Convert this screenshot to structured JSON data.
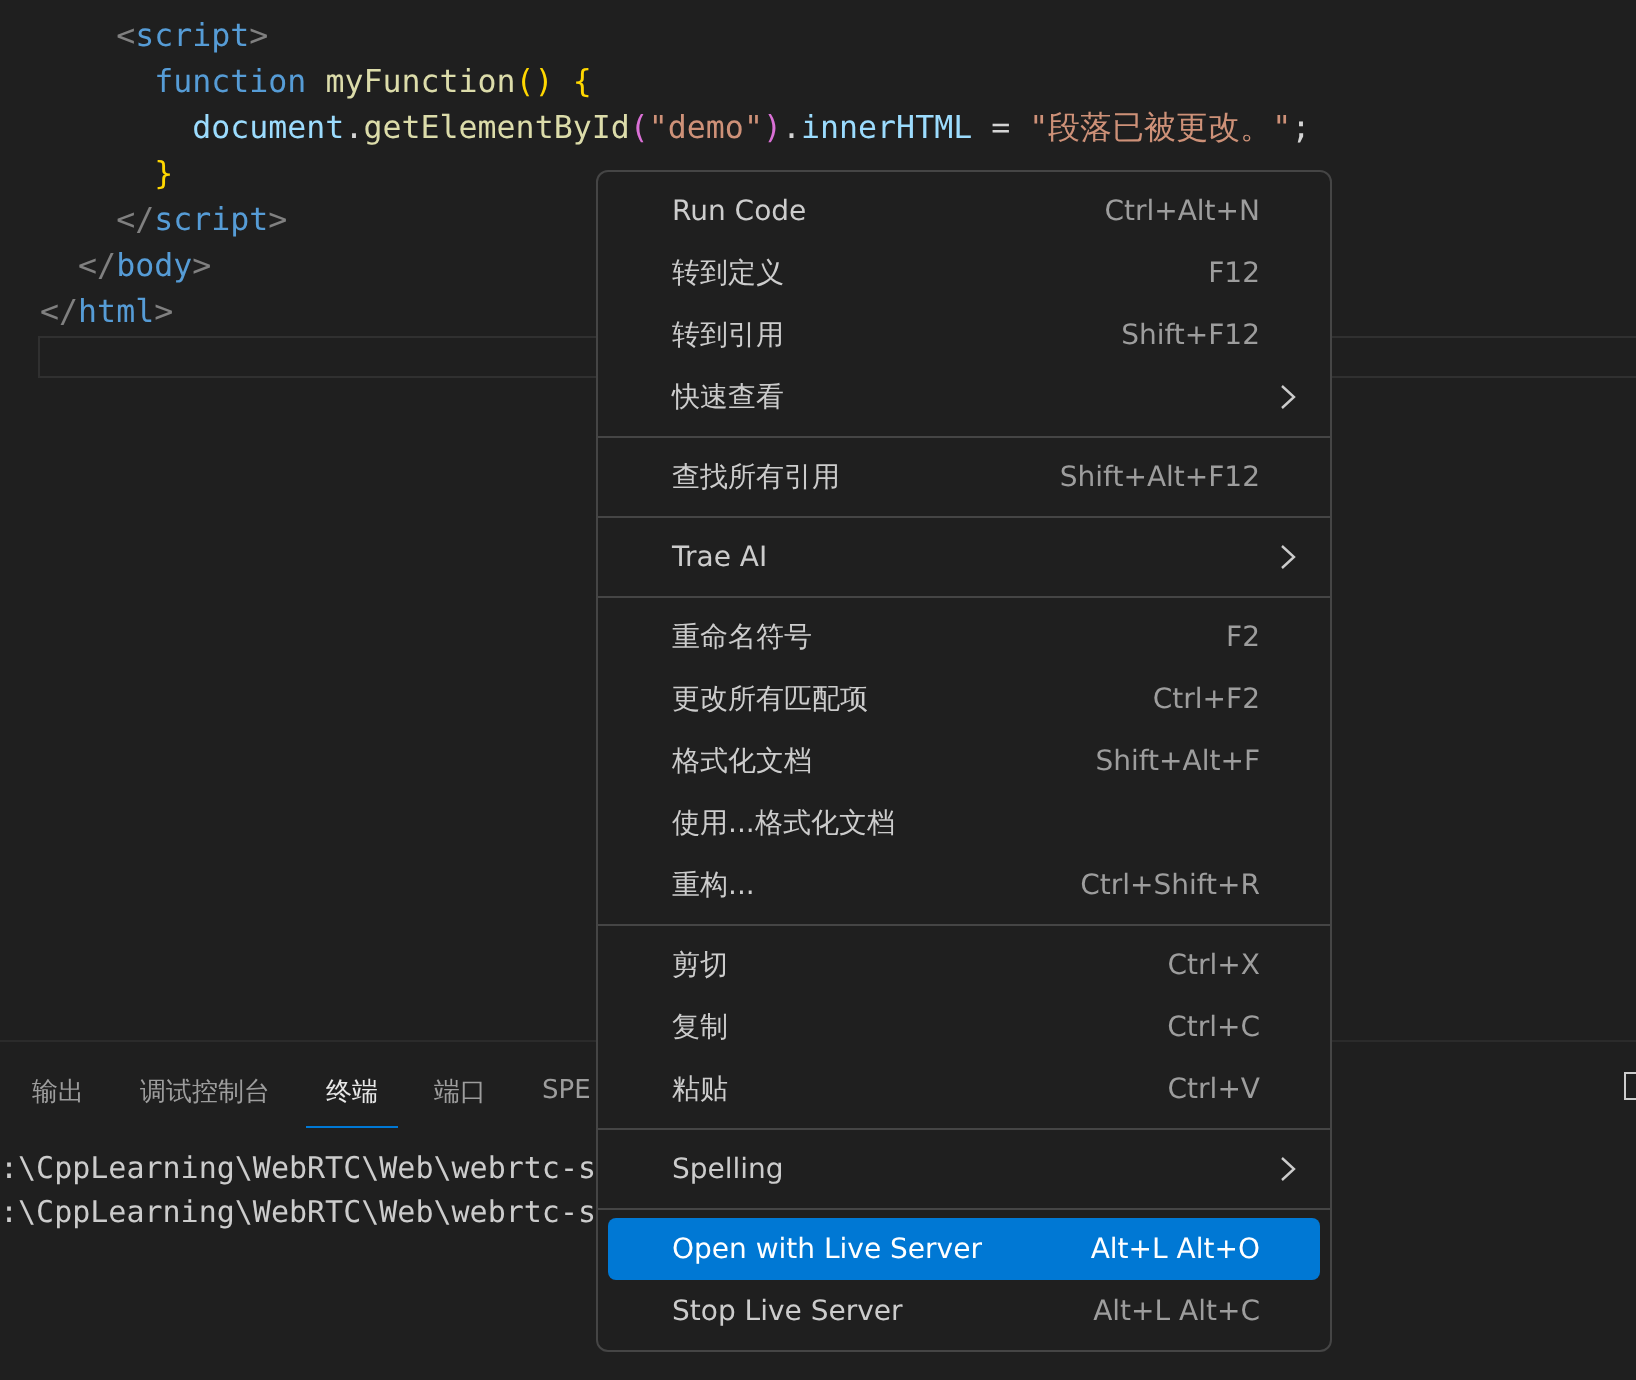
{
  "editor": {
    "lines": [
      {
        "tokens": [
          {
            "kind": "punct",
            "text": "      <"
          },
          {
            "kind": "tag",
            "text": "script"
          },
          {
            "kind": "punct",
            "text": ">"
          }
        ]
      },
      {
        "tokens": [
          {
            "kind": "keyword",
            "text": "        function "
          },
          {
            "kind": "function",
            "text": "myFunction"
          },
          {
            "kind": "bracket",
            "text": "() {"
          }
        ]
      },
      {
        "tokens": [
          {
            "kind": "variable",
            "text": "          document"
          },
          {
            "kind": "plain",
            "text": "."
          },
          {
            "kind": "function",
            "text": "getElementById"
          },
          {
            "kind": "paren",
            "text": "("
          },
          {
            "kind": "string",
            "text": "\"demo\""
          },
          {
            "kind": "paren",
            "text": ")"
          },
          {
            "kind": "plain",
            "text": "."
          },
          {
            "kind": "variable",
            "text": "innerHTML"
          },
          {
            "kind": "plain",
            "text": " = "
          },
          {
            "kind": "string",
            "text": "\"段落已被更改。\""
          },
          {
            "kind": "plain",
            "text": ";"
          }
        ]
      },
      {
        "tokens": [
          {
            "kind": "bracket",
            "text": "        }"
          }
        ]
      },
      {
        "tokens": [
          {
            "kind": "punct",
            "text": "      </"
          },
          {
            "kind": "tag",
            "text": "script"
          },
          {
            "kind": "punct",
            "text": ">"
          }
        ]
      },
      {
        "tokens": [
          {
            "kind": "punct",
            "text": "    </"
          },
          {
            "kind": "tag",
            "text": "body"
          },
          {
            "kind": "punct",
            "text": ">"
          }
        ]
      },
      {
        "tokens": [
          {
            "kind": "punct",
            "text": "  </"
          },
          {
            "kind": "tag",
            "text": "html"
          },
          {
            "kind": "punct",
            "text": ">"
          }
        ]
      }
    ]
  },
  "panel": {
    "tabs": [
      {
        "label": "输出",
        "selected": false
      },
      {
        "label": "调试控制台",
        "selected": false
      },
      {
        "label": "终端",
        "selected": true
      },
      {
        "label": "端口",
        "selected": false
      },
      {
        "label": "SPE",
        "selected": false
      }
    ],
    "terminal_lines": [
      ":\\CppLearning\\WebRTC\\Web\\webrtc-s",
      ":\\CppLearning\\WebRTC\\Web\\webrtc-s"
    ]
  },
  "context_menu": {
    "items": [
      {
        "kind": "item",
        "label": "Run Code",
        "shortcut": "Ctrl+Alt+N",
        "submenu": false,
        "selected": false
      },
      {
        "kind": "item",
        "label": "转到定义",
        "shortcut": "F12",
        "submenu": false,
        "selected": false
      },
      {
        "kind": "item",
        "label": "转到引用",
        "shortcut": "Shift+F12",
        "submenu": false,
        "selected": false
      },
      {
        "kind": "item",
        "label": "快速查看",
        "submenu": true,
        "selected": false
      },
      {
        "kind": "separator"
      },
      {
        "kind": "item",
        "label": "查找所有引用",
        "shortcut": "Shift+Alt+F12",
        "submenu": false,
        "selected": false
      },
      {
        "kind": "separator"
      },
      {
        "kind": "item",
        "label": "Trae AI",
        "submenu": true,
        "selected": false
      },
      {
        "kind": "separator"
      },
      {
        "kind": "item",
        "label": "重命名符号",
        "shortcut": "F2",
        "submenu": false,
        "selected": false
      },
      {
        "kind": "item",
        "label": "更改所有匹配项",
        "shortcut": "Ctrl+F2",
        "submenu": false,
        "selected": false
      },
      {
        "kind": "item",
        "label": "格式化文档",
        "shortcut": "Shift+Alt+F",
        "submenu": false,
        "selected": false
      },
      {
        "kind": "item",
        "label": "使用...格式化文档",
        "submenu": false,
        "selected": false
      },
      {
        "kind": "item",
        "label": "重构...",
        "shortcut": "Ctrl+Shift+R",
        "submenu": false,
        "selected": false
      },
      {
        "kind": "separator"
      },
      {
        "kind": "item",
        "label": "剪切",
        "shortcut": "Ctrl+X",
        "submenu": false,
        "selected": false
      },
      {
        "kind": "item",
        "label": "复制",
        "shortcut": "Ctrl+C",
        "submenu": false,
        "selected": false
      },
      {
        "kind": "item",
        "label": "粘贴",
        "shortcut": "Ctrl+V",
        "submenu": false,
        "selected": false
      },
      {
        "kind": "separator"
      },
      {
        "kind": "item",
        "label": "Spelling",
        "submenu": true,
        "selected": false
      },
      {
        "kind": "separator"
      },
      {
        "kind": "item",
        "label": "Open with Live Server",
        "shortcut": "Alt+L Alt+O",
        "submenu": false,
        "selected": true
      },
      {
        "kind": "item",
        "label": "Stop Live Server",
        "shortcut": "Alt+L Alt+C",
        "submenu": false,
        "selected": false
      }
    ]
  }
}
